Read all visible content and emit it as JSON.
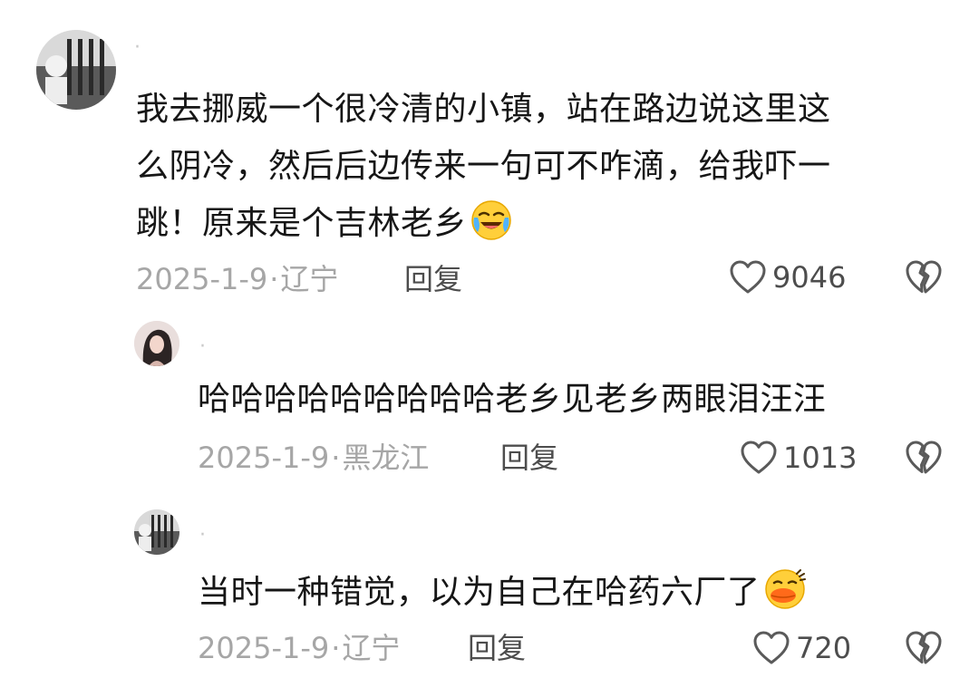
{
  "comments": [
    {
      "text": "我去挪威一个很冷清的小镇，站在路边说这里这么阴冷，然后后边传来一句可不咋滴，给我吓一跳！原来是个吉林老乡",
      "text_lines": [
        "我去挪威一个很冷清的小镇，站在路边说这里这",
        "么阴冷，然后后边传来一句可不咋滴，给我吓一",
        "跳！原来是个吉林老乡"
      ],
      "emoji": "crying-laughing-emoji",
      "date": "2025-1-9",
      "location": "辽宁",
      "reply_label": "回复",
      "likes": "9046"
    },
    {
      "text": "哈哈哈哈哈哈哈哈哈老乡见老乡两眼泪汪汪",
      "date": "2025-1-9",
      "location": "黑龙江",
      "reply_label": "回复",
      "likes": "1013"
    },
    {
      "text": "当时一种错觉，以为自己在哈药六厂了",
      "emoji": "duck-face-emoji",
      "date": "2025-1-9",
      "location": "辽宁",
      "reply_label": "回复",
      "likes": "720"
    }
  ],
  "meta_separator": "·",
  "icons": {
    "like": "heart-outline-icon",
    "dislike": "broken-heart-icon"
  },
  "colors": {
    "text": "#161616",
    "meta": "#a6a6a6",
    "action": "#4d4d4d",
    "icon": "#5a5a5a"
  }
}
